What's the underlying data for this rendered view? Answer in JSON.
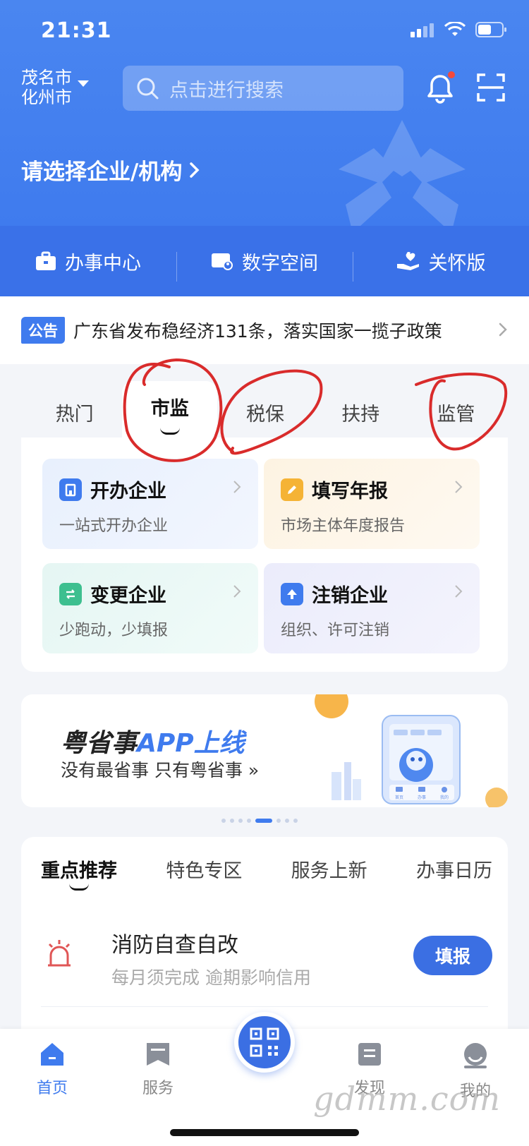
{
  "status_bar": {
    "time": "21:31"
  },
  "header": {
    "city_line1": "茂名市",
    "city_line2": "化州市",
    "search_placeholder": "点击进行搜索",
    "choose_org": "请选择企业/机构"
  },
  "quick_bar": [
    {
      "label": "办事中心",
      "icon": "briefcase-icon"
    },
    {
      "label": "数字空间",
      "icon": "digital-space-icon"
    },
    {
      "label": "关怀版",
      "icon": "care-hand-icon"
    }
  ],
  "notice": {
    "badge": "公告",
    "text": "广东省发布稳经济131条，落实国家一揽子政策"
  },
  "category_tabs": [
    "热门",
    "市监",
    "税保",
    "扶持",
    "监管"
  ],
  "category_active_index": 1,
  "services": [
    {
      "title": "开办企业",
      "subtitle": "一站式开办企业",
      "icon": "building-icon",
      "color": "#3f7bee"
    },
    {
      "title": "填写年报",
      "subtitle": "市场主体年度报告",
      "icon": "pencil-icon",
      "color": "#f5b335"
    },
    {
      "title": "变更企业",
      "subtitle": "少跑动，少填报",
      "icon": "swap-icon",
      "color": "#3dbf8f"
    },
    {
      "title": "注销企业",
      "subtitle": "组织、许可注销",
      "icon": "arrow-up-icon",
      "color": "#3f7bee"
    }
  ],
  "banner": {
    "title_main": "粤省事",
    "title_accent": "APP上线",
    "subtitle": "没有最省事  只有粤省事 »",
    "mini_labels": [
      "首页",
      "办事",
      "我的"
    ]
  },
  "recommend_tabs": [
    "重点推荐",
    "特色专区",
    "服务上新",
    "办事日历"
  ],
  "recommend_item": {
    "title": "消防自查自改",
    "subtitle": "每月须完成 逾期影响信用",
    "button": "填报"
  },
  "tab_bar": [
    {
      "label": "首页",
      "icon": "home-icon",
      "active": true
    },
    {
      "label": "服务",
      "icon": "bookmark-icon",
      "active": false
    },
    {
      "label": "发现",
      "icon": "discover-icon",
      "active": false
    },
    {
      "label": "我的",
      "icon": "profile-icon",
      "active": false
    }
  ],
  "watermark": "gdmm.com",
  "colors": {
    "primary": "#3f7bee",
    "annotation": "#d92b2b"
  }
}
